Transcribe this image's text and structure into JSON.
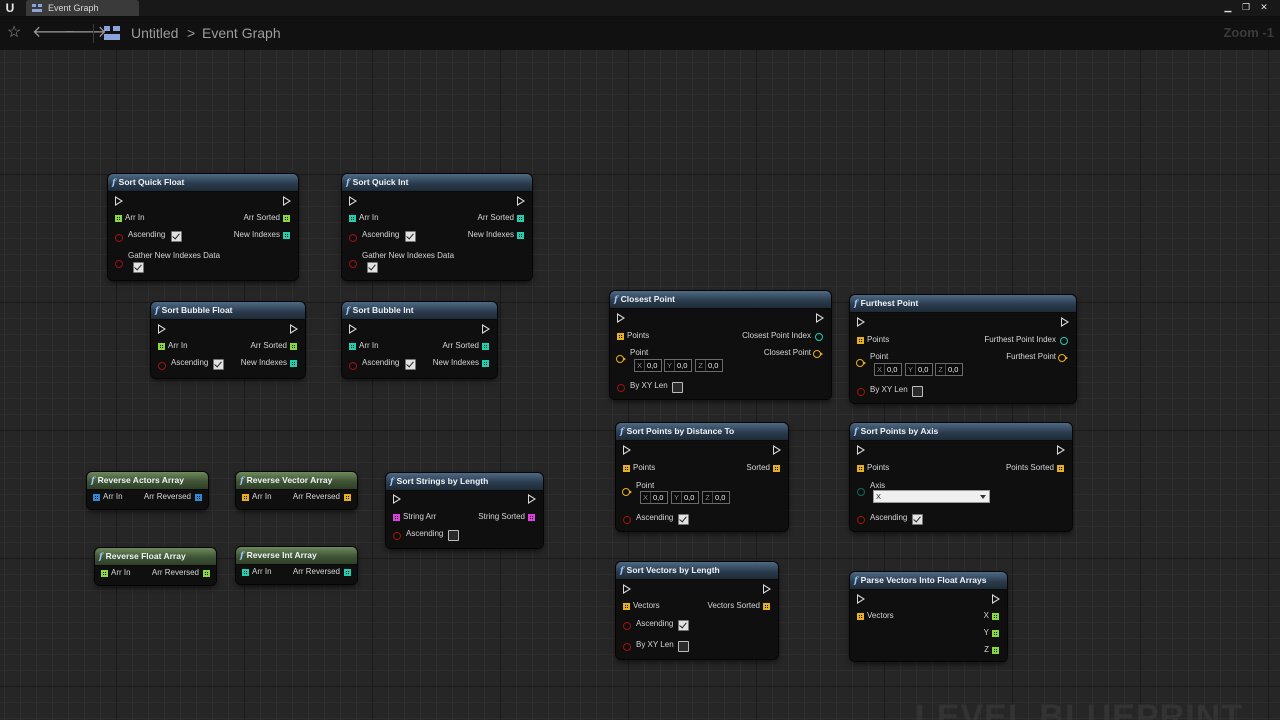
{
  "window": {
    "tab_label": "Event Graph",
    "logo": "U",
    "controls": [
      "▁",
      "❐",
      "✕"
    ]
  },
  "toolbar": {
    "icons": [
      "star-icon",
      "back-arrow-icon",
      "forward-arrow-icon",
      "graph-icon"
    ],
    "breadcrumb": [
      "Untitled",
      "Event Graph"
    ],
    "separator": ">",
    "zoom": "Zoom -1"
  },
  "watermark": "LEVEL BLUEPRINT",
  "colors": {
    "float_pin": "#88d840",
    "int_pin": "#20d0b0",
    "actor_pin": "#2e8ad8",
    "vector_pin": "#e8b020",
    "string_pin": "#e040e0",
    "bool_pin": "#a01010"
  },
  "nodes": {
    "sort_quick_float": {
      "title": "Sort Quick Float",
      "arr_in": "Arr In",
      "arr_sorted": "Arr Sorted",
      "ascending": "Ascending",
      "new_indexes": "New Indexes",
      "gather": "Gather New Indexes Data"
    },
    "sort_quick_int": {
      "title": "Sort Quick Int",
      "arr_in": "Arr In",
      "arr_sorted": "Arr Sorted",
      "ascending": "Ascending",
      "new_indexes": "New Indexes",
      "gather": "Gather New Indexes Data"
    },
    "sort_bubble_float": {
      "title": "Sort Bubble Float",
      "arr_in": "Arr In",
      "arr_sorted": "Arr Sorted",
      "ascending": "Ascending",
      "new_indexes": "New Indexes"
    },
    "sort_bubble_int": {
      "title": "Sort Bubble Int",
      "arr_in": "Arr In",
      "arr_sorted": "Arr Sorted",
      "ascending": "Ascending",
      "new_indexes": "New Indexes"
    },
    "reverse_actors": {
      "title": "Reverse Actors Array",
      "arr_in": "Arr In",
      "arr_out": "Arr Reversed"
    },
    "reverse_vector": {
      "title": "Reverse Vector Array",
      "arr_in": "Arr In",
      "arr_out": "Arr Reversed"
    },
    "reverse_float": {
      "title": "Reverse Float Array",
      "arr_in": "Arr In",
      "arr_out": "Arr Reversed"
    },
    "reverse_int": {
      "title": "Reverse Int Array",
      "arr_in": "Arr In",
      "arr_out": "Arr Reversed"
    },
    "sort_strings": {
      "title": "Sort Strings by Length",
      "string_arr": "String Arr",
      "string_sorted": "String Sorted",
      "ascending": "Ascending"
    },
    "closest_point": {
      "title": "Closest Point",
      "points": "Points",
      "index": "Closest Point Index",
      "point": "Point",
      "out_point": "Closest Point",
      "x": "0,0",
      "y": "0,0",
      "z": "0,0",
      "by_xy": "By XY Len"
    },
    "furthest_point": {
      "title": "Furthest Point",
      "points": "Points",
      "index": "Furthest Point Index",
      "point": "Point",
      "out_point": "Furthest Point",
      "x": "0,0",
      "y": "0,0",
      "z": "0,0",
      "by_xy": "By XY Len"
    },
    "sort_points_distance": {
      "title": "Sort Points by Distance To",
      "points": "Points",
      "sorted": "Sorted",
      "point": "Point",
      "x": "0,0",
      "y": "0,0",
      "z": "0,0",
      "ascending": "Ascending"
    },
    "sort_points_axis": {
      "title": "Sort Points by Axis",
      "points": "Points",
      "points_sorted": "Points Sorted",
      "axis": "Axis",
      "axis_value": "X",
      "ascending": "Ascending"
    },
    "sort_vectors_length": {
      "title": "Sort Vectors by Length",
      "vectors": "Vectors",
      "vectors_sorted": "Vectors Sorted",
      "ascending": "Ascending",
      "by_xy": "By XY Len"
    },
    "parse_vectors": {
      "title": "Parse Vectors Into Float Arrays",
      "vectors": "Vectors",
      "x": "X",
      "y": "Y",
      "z": "Z"
    }
  },
  "axis_labels": {
    "x": "X",
    "y": "Y",
    "z": "Z"
  }
}
